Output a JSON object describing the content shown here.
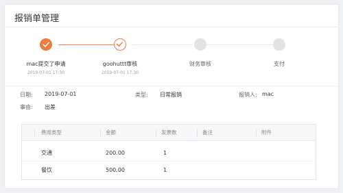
{
  "page": {
    "title": "报销单管理"
  },
  "steps": [
    {
      "title": "mac提交了申请",
      "time": "2019-07-01 17:30",
      "status": "done"
    },
    {
      "title": "goohuttt审核",
      "time": "2019-07-01 17:30",
      "status": "current"
    },
    {
      "title": "财务审核",
      "time": "",
      "status": "wait"
    },
    {
      "title": "支付",
      "time": "",
      "status": "wait"
    }
  ],
  "details": {
    "date_label": "日期:",
    "date_value": "2019-07-01",
    "type_label": "类型:",
    "type_value": "日常报销",
    "applicant_label": "报销人:",
    "applicant_value": "mac",
    "reason_label": "事由:",
    "reason_value": "出差"
  },
  "table": {
    "columns": [
      "费用类型",
      "金额",
      "发票数",
      "备注",
      "附件"
    ],
    "rows": [
      {
        "type": "交通",
        "amount": "200.00",
        "invoices": "1",
        "note": "",
        "attachment": ""
      },
      {
        "type": "餐饮",
        "amount": "500.00",
        "invoices": "1",
        "note": "",
        "attachment": ""
      }
    ]
  },
  "colors": {
    "accent": "#f07b3f",
    "pending": "#e3e3e3"
  }
}
